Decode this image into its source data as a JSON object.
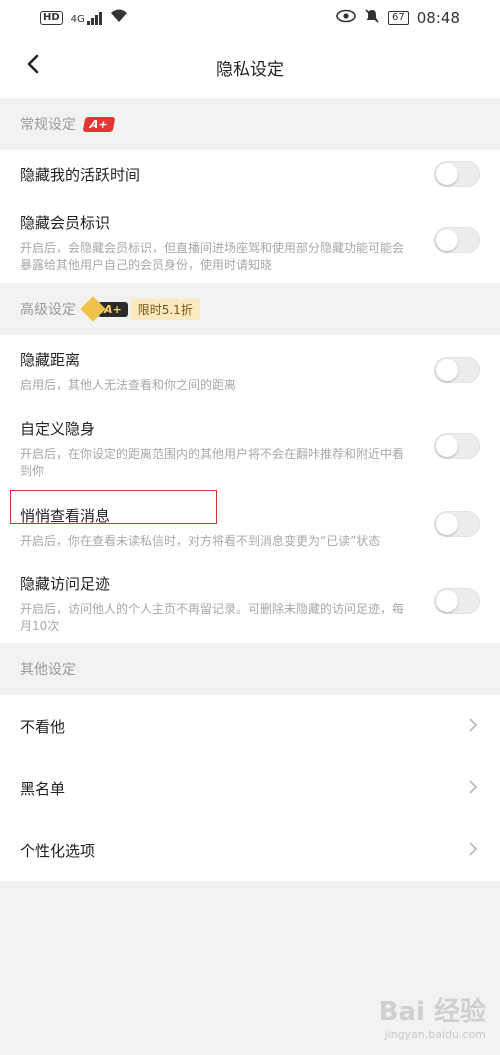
{
  "status_bar": {
    "hd": "HD",
    "network": "4G",
    "battery": "67",
    "time": "08:48"
  },
  "header": {
    "title": "隐私设定"
  },
  "sections": {
    "general": {
      "label": "常规设定",
      "badge": "A+"
    },
    "advanced": {
      "label": "高级设定",
      "badge": "A+",
      "promo": "限时5.1折"
    },
    "other": {
      "label": "其他设定"
    }
  },
  "general_items": [
    {
      "title": "隐藏我的活跃时间",
      "desc": "",
      "enabled": false
    },
    {
      "title": "隐藏会员标识",
      "desc": "开启后，会隐藏会员标识，但直播间进场座驾和使用部分隐藏功能可能会暴露给其他用户自己的会员身份，使用时请知晓",
      "enabled": false
    }
  ],
  "advanced_items": [
    {
      "title": "隐藏距离",
      "desc": "启用后，其他人无法查看和你之间的距离",
      "enabled": false
    },
    {
      "title": "自定义隐身",
      "desc": "开启后，在你设定的距离范围内的其他用户将不会在翻咔推荐和附近中看到你",
      "enabled": false
    },
    {
      "title": "悄悄查看消息",
      "desc": "开启后，你在查看未读私信时，对方将看不到消息变更为“已读”状态",
      "enabled": false
    },
    {
      "title": "隐藏访问足迹",
      "desc": "开启后，访问他人的个人主页不再留记录。可删除未隐藏的访问足迹，每月10次",
      "enabled": false
    }
  ],
  "other_items": [
    {
      "label": "不看他"
    },
    {
      "label": "黑名单"
    },
    {
      "label": "个性化选项"
    }
  ],
  "watermark": {
    "brand": "Bai 经验",
    "url": "jingyan.baidu.com"
  },
  "colors": {
    "accent_red": "#e63434",
    "highlight_box": "#d9322f",
    "background": "#f2f2f2"
  }
}
